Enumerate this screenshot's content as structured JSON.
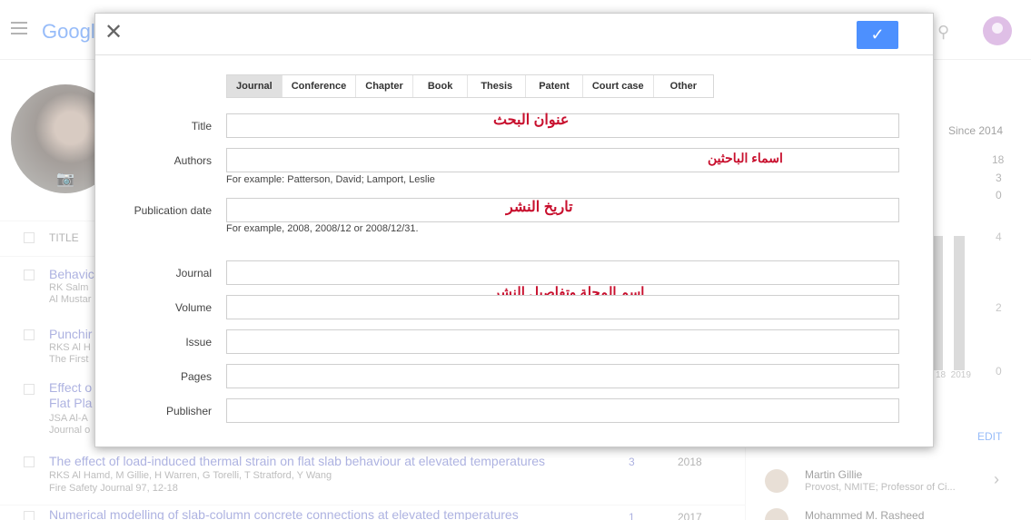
{
  "background": {
    "logo": "Googl",
    "title_column": "TITLE",
    "since_label": "Since 2014",
    "stats": [
      "18",
      "3",
      "0"
    ],
    "chart_axis": [
      "4",
      "2",
      "0"
    ],
    "chart_years": "18  2019",
    "edit_label": "EDIT",
    "articles": [
      {
        "title": "Behavic",
        "authors": "RK Salm",
        "venue": "Al Mustar"
      },
      {
        "title": "Punchir",
        "authors": "RKS Al H",
        "venue": "The First"
      },
      {
        "title": "Effect o",
        "title2": "Flat Pla",
        "authors": "JSA Al-A",
        "venue": "Journal o"
      },
      {
        "title": "The effect of load-induced thermal strain on flat slab behaviour at elevated temperatures",
        "authors": "RKS Al Hamd, M Gillie, H Warren, G Torelli, T Stratford, Y Wang",
        "venue": "Fire Safety Journal 97, 12-18",
        "cited": "3",
        "year": "2018"
      },
      {
        "title": "Numerical modelling of slab-column concrete connections at elevated temperatures",
        "cited": "1",
        "year": "2017"
      }
    ],
    "coauthors": [
      {
        "name": "Martin Gillie",
        "affiliation": "Provost, NMITE; Professor of Ci..."
      },
      {
        "name": "Mohammed M. Rasheed",
        "affiliation": ""
      }
    ]
  },
  "dialog": {
    "close_glyph": "✕",
    "save_glyph": "✓",
    "tabs": [
      "Journal",
      "Conference",
      "Chapter",
      "Book",
      "Thesis",
      "Patent",
      "Court case",
      "Other"
    ],
    "active_tab": "Journal",
    "fields": {
      "title": {
        "label": "Title",
        "value": ""
      },
      "authors": {
        "label": "Authors",
        "value": "",
        "hint": "For example: Patterson, David; Lamport, Leslie"
      },
      "publication_date": {
        "label": "Publication date",
        "value": "",
        "hint": "For example, 2008, 2008/12 or 2008/12/31."
      },
      "journal": {
        "label": "Journal",
        "value": ""
      },
      "volume": {
        "label": "Volume",
        "value": ""
      },
      "issue": {
        "label": "Issue",
        "value": ""
      },
      "pages": {
        "label": "Pages",
        "value": ""
      },
      "publisher": {
        "label": "Publisher",
        "value": ""
      }
    },
    "annotations": {
      "title": "عنوان البحث",
      "authors": "اسماء الباحثين",
      "date": "تاريخ النشر",
      "journal": "اسم المجلة وتفاصيل النشر"
    },
    "accent_color": "#4d90fe",
    "annotation_color": "#c8102e"
  }
}
